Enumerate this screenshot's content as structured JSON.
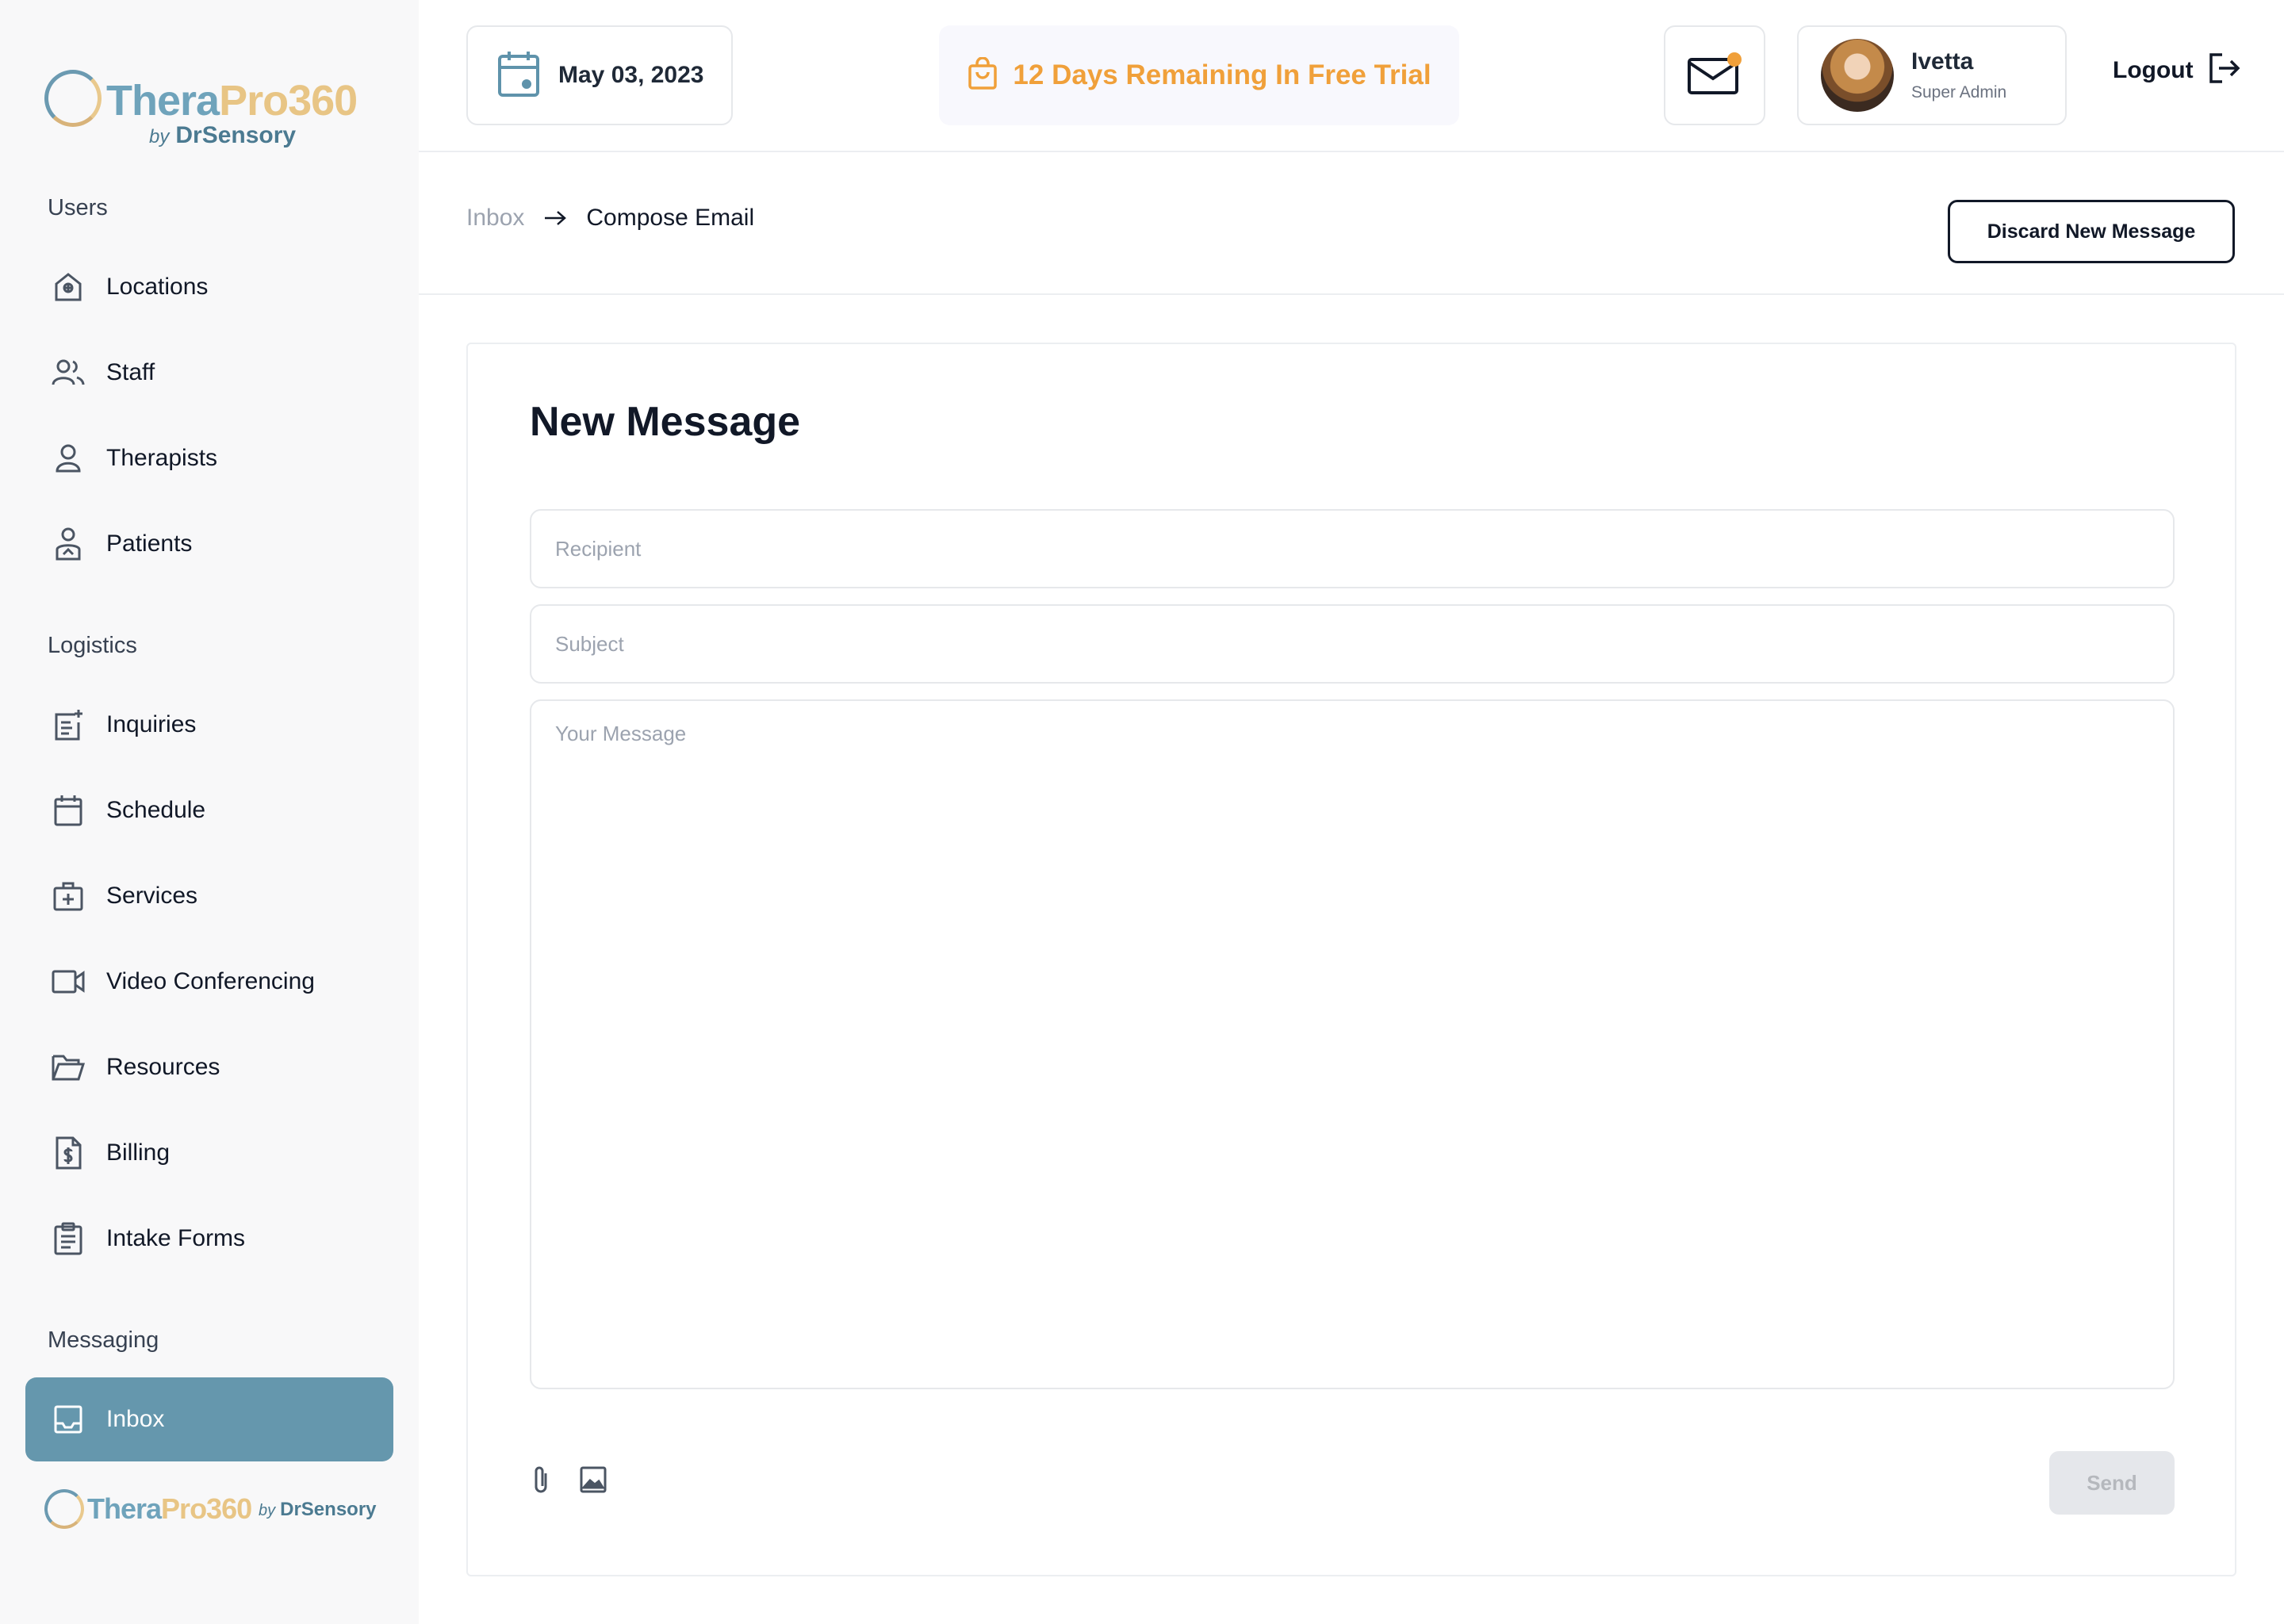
{
  "brand": {
    "name_part1": "Thera",
    "name_part2": "Pro360",
    "by_prefix": "by",
    "by_name": "DrSensory",
    "colors": {
      "primary": "#6597ad",
      "accent": "#e8c585",
      "trial": "#f0a03a"
    }
  },
  "sidebar": {
    "sections": [
      {
        "title": "Users",
        "items": [
          {
            "label": "Locations",
            "icon": "location-house-icon"
          },
          {
            "label": "Staff",
            "icon": "staff-icon"
          },
          {
            "label": "Therapists",
            "icon": "user-icon"
          },
          {
            "label": "Patients",
            "icon": "patient-icon"
          }
        ]
      },
      {
        "title": "Logistics",
        "items": [
          {
            "label": "Inquiries",
            "icon": "inquiry-icon"
          },
          {
            "label": "Schedule",
            "icon": "calendar-icon"
          },
          {
            "label": "Services",
            "icon": "medical-kit-icon"
          },
          {
            "label": "Video Conferencing",
            "icon": "video-icon"
          },
          {
            "label": "Resources",
            "icon": "folder-icon"
          },
          {
            "label": "Billing",
            "icon": "bill-icon"
          },
          {
            "label": "Intake Forms",
            "icon": "clipboard-icon"
          }
        ]
      },
      {
        "title": "Messaging",
        "items": [
          {
            "label": "Inbox",
            "icon": "inbox-icon",
            "active": true
          }
        ]
      }
    ]
  },
  "header": {
    "date": "May 03, 2023",
    "trial": "12 Days Remaining In Free Trial",
    "user": {
      "name": "Ivetta",
      "role": "Super Admin"
    },
    "logout": "Logout"
  },
  "breadcrumb": {
    "parent": "Inbox",
    "current": "Compose Email"
  },
  "actions": {
    "discard": "Discard New Message"
  },
  "compose": {
    "title": "New Message",
    "recipient_placeholder": "Recipient",
    "subject_placeholder": "Subject",
    "message_placeholder": "Your Message",
    "send_label": "Send"
  }
}
